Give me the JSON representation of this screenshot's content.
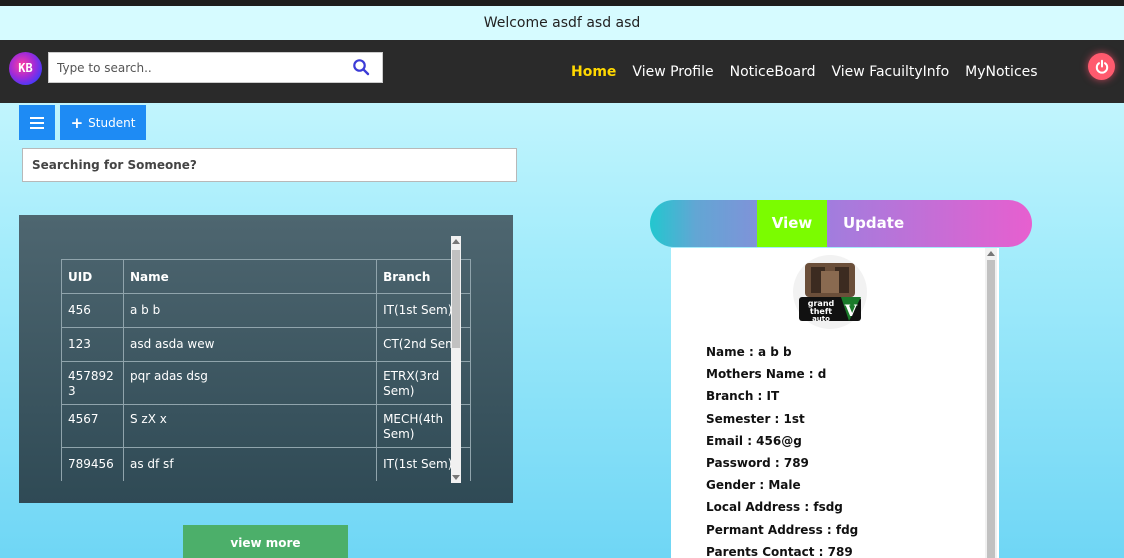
{
  "welcome": {
    "text": "Welcome asdf asd asd"
  },
  "header": {
    "logo_text": "KB",
    "search": {
      "placeholder": "Type to search..",
      "value": ""
    },
    "nav": [
      {
        "label": "Home",
        "active": true
      },
      {
        "label": "View Profile",
        "active": false
      },
      {
        "label": "NoticeBoard",
        "active": false
      },
      {
        "label": "View FacuiltyInfo",
        "active": false
      },
      {
        "label": "MyNotices",
        "active": false
      }
    ]
  },
  "toolbar": {
    "add_student_label": "Student"
  },
  "student_search": {
    "placeholder": "Searching for Someone?",
    "value": ""
  },
  "table": {
    "headers": [
      "UID",
      "Name",
      "Branch"
    ],
    "rows": [
      {
        "uid": "456",
        "name": "a b b",
        "branch": "IT(1st Sem)"
      },
      {
        "uid": "123",
        "name": "asd asda wew",
        "branch": "CT(2nd Sem)"
      },
      {
        "uid": "4578923",
        "name": "pqr adas dsg",
        "branch": "ETRX(3rd Sem)"
      },
      {
        "uid": "4567",
        "name": "S zX x",
        "branch": "MECH(4th Sem)"
      },
      {
        "uid": "789456",
        "name": "as df sf",
        "branch": "IT(1st Sem)"
      }
    ]
  },
  "view_more_label": "view more",
  "profile_tabs": {
    "view": "View",
    "update": "Update"
  },
  "profile": {
    "avatar_text": "Grand Theft Auto V",
    "fields": [
      "Name : a b b",
      "Mothers Name : d",
      "Branch : IT",
      "Semester : 1st",
      "Email : 456@g",
      "Password : 789",
      "Gender : Male",
      "Local Address : fsdg",
      "Permant Address : fdg",
      "Parents Contact : 789"
    ]
  },
  "colors": {
    "nav_active": "#ffd800",
    "primary_button": "#1e8bf4",
    "view_more": "#4caf6a",
    "tab_view": "#7bfc00",
    "power": "#ff5a6e"
  }
}
